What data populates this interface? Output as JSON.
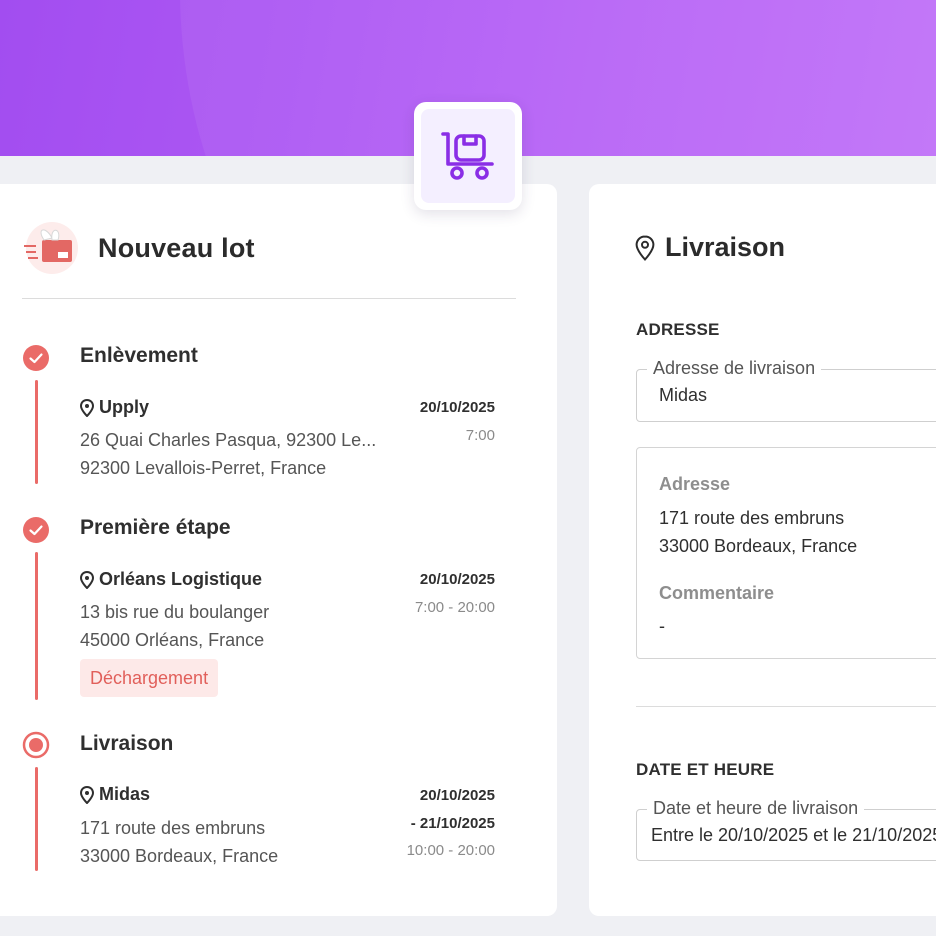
{
  "colors": {
    "accent": "#ea6b68",
    "brand": "#a24df0",
    "tag_bg": "#fde9e8"
  },
  "icons": {
    "header_tile": "cart-icon",
    "lot": "flying-parcel-icon",
    "pin": "location-pin-icon",
    "done": "check-circle-icon",
    "current": "radio-dot-icon"
  },
  "lot": {
    "title": "Nouveau lot",
    "stops": [
      {
        "title": "Enlèvement",
        "status": "done",
        "place": "Upply",
        "address_line1": "26 Quai Charles Pasqua, 92300 Le...",
        "address_line2": "92300 Levallois-Perret, France",
        "date": "20/10/2025",
        "time": "7:00"
      },
      {
        "title": "Première étape",
        "status": "done",
        "place": "Orléans Logistique",
        "address_line1": "13 bis rue du boulanger",
        "address_line2": "45000 Orléans, France",
        "date": "20/10/2025",
        "time": "7:00 - 20:00",
        "tag": "Déchargement"
      },
      {
        "title": "Livraison",
        "status": "current",
        "place": "Midas",
        "address_line1": "171 route des embruns",
        "address_line2": "33000 Bordeaux, France",
        "date": "20/10/2025",
        "date_end": "- 21/10/2025",
        "time": "10:00 - 20:00"
      }
    ]
  },
  "delivery": {
    "title": "Livraison",
    "address_section": "ADRESSE",
    "address_field": {
      "label": "Adresse de livraison",
      "value": "Midas"
    },
    "address_label": "Adresse",
    "address_line1": "171 route des embruns",
    "address_line2": "33000 Bordeaux, France",
    "comment_label": "Commentaire",
    "comment_value": "-",
    "datetime_section": "DATE ET HEURE",
    "datetime_field": {
      "label": "Date et heure de livraison",
      "value": "Entre le 20/10/2025 et le 21/10/2025"
    }
  }
}
